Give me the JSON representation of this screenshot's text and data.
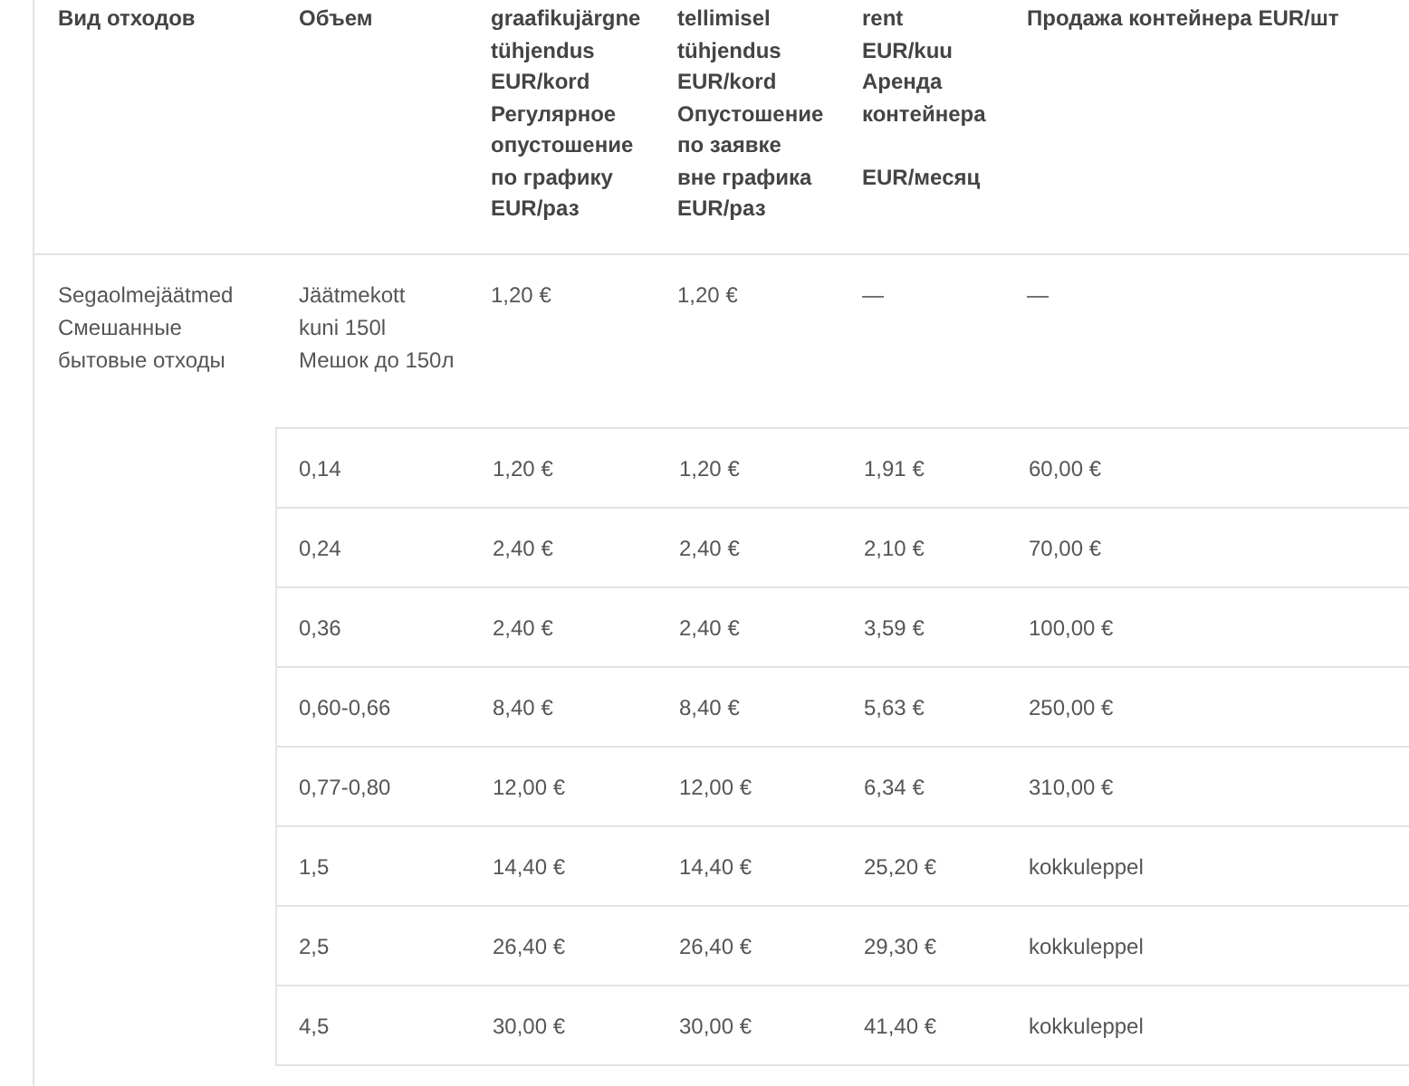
{
  "table": {
    "columns": [
      {
        "lines": [
          "Вид отходов"
        ]
      },
      {
        "lines": [
          "Объем"
        ]
      },
      {
        "lines": [
          "graafikujärgne",
          "tühjendus",
          "EUR/kord",
          "Регулярное",
          "опустошение",
          "по графику",
          "EUR/раз"
        ]
      },
      {
        "lines": [
          "tellimisel",
          "tühjendus",
          "EUR/kord",
          "Опустошение",
          "по заявке",
          "вне графика",
          "EUR/раз"
        ]
      },
      {
        "lines": [
          "rent",
          "EUR/kuu",
          "Аренда",
          "контейнера"
        ],
        "unit": "EUR/месяц"
      },
      {
        "lines": [
          "Продажа контейнера EUR/шт"
        ]
      }
    ],
    "rows": [
      {
        "kind": "group",
        "cells": [
          "Segaolmejäätmed\nСмешанные\nбытовые отходы",
          "Jäätmekott\nkuni 150l\nМешок до 150л",
          "1,20 €",
          "1,20 €",
          "—",
          "—"
        ]
      },
      {
        "kind": "item",
        "cells": [
          "",
          "0,14",
          "1,20 €",
          "1,20 €",
          "1,91 €",
          "60,00 €"
        ]
      },
      {
        "kind": "item",
        "cells": [
          "",
          "0,24",
          "2,40 €",
          "2,40 €",
          "2,10 €",
          "70,00 €"
        ]
      },
      {
        "kind": "item",
        "cells": [
          "",
          "0,36",
          "2,40 €",
          "2,40 €",
          "3,59 €",
          "100,00 €"
        ]
      },
      {
        "kind": "item",
        "cells": [
          "",
          "0,60-0,66",
          "8,40 €",
          "8,40 €",
          "5,63 €",
          "250,00 €"
        ]
      },
      {
        "kind": "item",
        "cells": [
          "",
          "0,77-0,80",
          "12,00 €",
          "12,00 €",
          "6,34 €",
          "310,00 €"
        ]
      },
      {
        "kind": "item",
        "cells": [
          "",
          "1,5",
          "14,40 €",
          "14,40 €",
          "25,20 €",
          "kokkuleppel"
        ]
      },
      {
        "kind": "item",
        "cells": [
          "",
          "2,5",
          "26,40 €",
          "26,40 €",
          "29,30 €",
          "kokkuleppel"
        ]
      },
      {
        "kind": "item",
        "cells": [
          "",
          "4,5",
          "30,00 €",
          "30,00 €",
          "41,40 €",
          "kokkuleppel"
        ]
      }
    ]
  }
}
